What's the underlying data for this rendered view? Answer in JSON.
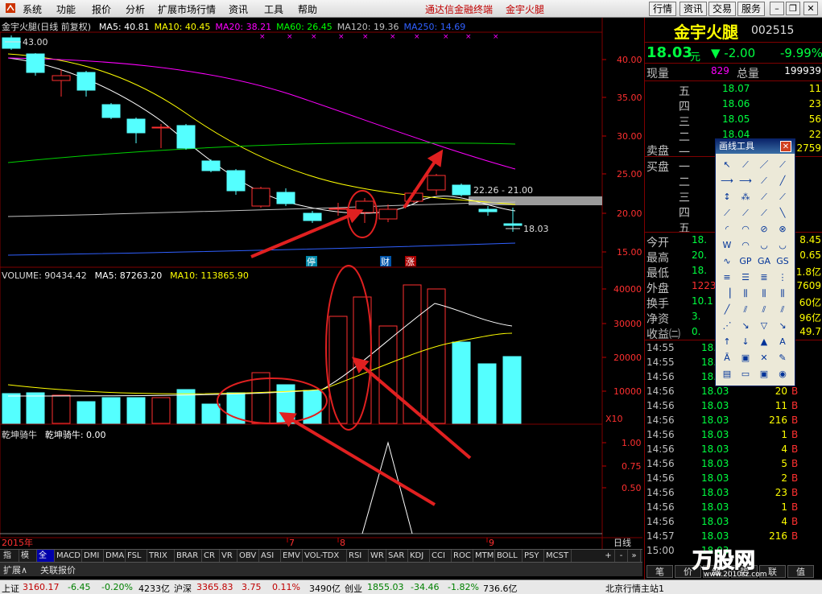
{
  "menubar": {
    "items": [
      "系统",
      "功能",
      "报价",
      "分析",
      "扩展市场行情",
      "资讯",
      "工具",
      "帮助"
    ],
    "brand": "通达信金融终端",
    "stock_title": "金宇火腿",
    "right_buttons": [
      "行情",
      "资讯",
      "交易",
      "服务"
    ]
  },
  "kline": {
    "title": "金宇火腿(日线 前复权)",
    "ma_labels": [
      {
        "text": "MA5: 40.81",
        "color": "#ffffff"
      },
      {
        "text": "MA10: 40.45",
        "color": "#ffff00"
      },
      {
        "text": "MA20: 38.21",
        "color": "#ff00ff"
      },
      {
        "text": "MA60: 26.45",
        "color": "#00ff00"
      },
      {
        "text": "MA120: 19.36",
        "color": "#c0c0c0"
      },
      {
        "text": "MA250: 14.69",
        "color": "#3060ff"
      }
    ],
    "high_label": "43.00",
    "range_label": "22.26 - 21.00",
    "last_label": "18.03",
    "yticks": [
      "40.00",
      "35.00",
      "30.00",
      "25.00",
      "20.00",
      "15.00"
    ],
    "event_badges": [
      "停",
      "财",
      "涨"
    ]
  },
  "volume": {
    "title": "VOLUME: 90434.42",
    "ma5": "MA5: 87263.20",
    "ma10": "MA10: 113865.90",
    "yticks": [
      "40000",
      "30000",
      "20000",
      "10000"
    ],
    "unit": "X10"
  },
  "indicator": {
    "title": "乾坤骑牛",
    "value": "乾坤骑牛: 0.00",
    "yticks": [
      "1.00",
      "0.75",
      "0.50"
    ]
  },
  "date_axis": {
    "year": "2015年",
    "months": [
      "7",
      "8",
      "9"
    ],
    "mode": "日线"
  },
  "tabs": [
    "指标",
    "模板",
    "全部",
    "MACD",
    "DMI",
    "DMA",
    "FSL",
    "TRIX",
    "BRAR",
    "CR",
    "VR",
    "OBV",
    "ASI",
    "EMV",
    "VOL-TDX",
    "RSI",
    "WR",
    "SAR",
    "KDJ",
    "CCI",
    "ROC",
    "MTM",
    "BOLL",
    "PSY",
    "MCST"
  ],
  "expand": {
    "left": "扩展∧",
    "right": "关联报价"
  },
  "quote": {
    "name": "金宇火腿",
    "code": "002515",
    "price": "18.03",
    "unit": "元",
    "change": "▼ -2.00",
    "pct": "-9.99%",
    "now_label": "现量",
    "now_val": "829",
    "total_label": "总量",
    "total_val": "199939",
    "sell": [
      {
        "lvl": "五",
        "price": "18.07",
        "vol": "11"
      },
      {
        "lvl": "四",
        "price": "18.06",
        "vol": "23"
      },
      {
        "lvl": "三",
        "price": "18.05",
        "vol": "56"
      },
      {
        "lvl": "二",
        "price": "18.04",
        "vol": "22"
      },
      {
        "lvl": "一",
        "price": "",
        "vol": ""
      }
    ],
    "sell_label": "卖盘",
    "buy_label": "买盘",
    "sell_total": "2759",
    "buy_levels": [
      "一",
      "二",
      "三",
      "四",
      "五"
    ],
    "stats": [
      {
        "l": "今开",
        "v": "18.",
        "r": "8.45"
      },
      {
        "l": "最高",
        "v": "20.",
        "r": "0.65"
      },
      {
        "l": "最低",
        "v": "18.",
        "r": "1.8亿"
      },
      {
        "l": "外盘",
        "v": "1223",
        "r": "7609"
      },
      {
        "l": "换手",
        "v": "10.1",
        "r": "60亿"
      },
      {
        "l": "净资",
        "v": "3.",
        "r": "96亿"
      },
      {
        "l": "收益㈡",
        "v": "0.",
        "r": "49.7"
      }
    ],
    "ticks": [
      {
        "t": "14:55",
        "p": "18.",
        "v": "",
        "s": ""
      },
      {
        "t": "14:55",
        "p": "18.",
        "v": "",
        "s": ""
      },
      {
        "t": "14:56",
        "p": "18.",
        "v": "",
        "s": ""
      },
      {
        "t": "14:56",
        "p": "18.03",
        "v": "20",
        "s": "B"
      },
      {
        "t": "14:56",
        "p": "18.03",
        "v": "11",
        "s": "B"
      },
      {
        "t": "14:56",
        "p": "18.03",
        "v": "216",
        "s": "B"
      },
      {
        "t": "14:56",
        "p": "18.03",
        "v": "1",
        "s": "B"
      },
      {
        "t": "14:56",
        "p": "18.03",
        "v": "4",
        "s": "B"
      },
      {
        "t": "14:56",
        "p": "18.03",
        "v": "5",
        "s": "B"
      },
      {
        "t": "14:56",
        "p": "18.03",
        "v": "2",
        "s": "B"
      },
      {
        "t": "14:56",
        "p": "18.03",
        "v": "23",
        "s": "B"
      },
      {
        "t": "14:56",
        "p": "18.03",
        "v": "1",
        "s": "B"
      },
      {
        "t": "14:56",
        "p": "18.03",
        "v": "4",
        "s": "B"
      },
      {
        "t": "14:57",
        "p": "18.03",
        "v": "216",
        "s": "B"
      },
      {
        "t": "15:00",
        "p": "18.03",
        "v": "",
        "s": ""
      }
    ],
    "bottom_tabs": [
      "笔",
      "价",
      "细",
      "势",
      "联",
      "值"
    ]
  },
  "draw_tool": {
    "title": "画线工具"
  },
  "status": {
    "sh_label": "上证",
    "sh_val": "3160.17",
    "sh_chg": "-6.45",
    "sh_pct": "-0.20%",
    "sh_amt": "4233亿",
    "hs_label": "沪深",
    "hs_val": "3365.83",
    "hs_chg": "3.75",
    "hs_pct": "0.11%",
    "hs_amt": "3490亿",
    "cy_label": "创业",
    "cy_val": "1855.03",
    "cy_chg": "-34.46",
    "cy_pct": "-1.82%",
    "cy_amt": "736.6亿",
    "server": "北京行情主站1",
    "watermark": "万股网",
    "watermark_url": "www.2010sz.com"
  }
}
